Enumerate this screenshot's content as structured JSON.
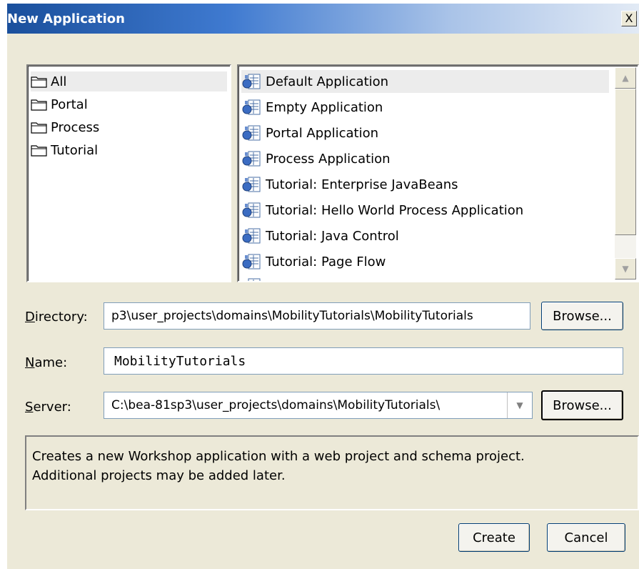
{
  "window": {
    "title": "New Application",
    "close_glyph": "X"
  },
  "categories": [
    "All",
    "Portal",
    "Process",
    "Tutorial"
  ],
  "templates": [
    "Default Application",
    "Empty Application",
    "Portal Application",
    "Process Application",
    "Tutorial: Enterprise JavaBeans",
    "Tutorial: Hello World Process Application",
    "Tutorial: Java Control",
    "Tutorial: Page Flow"
  ],
  "directory": {
    "label_key": "D",
    "label_rest": "irectory:",
    "value": "p3\\user_projects\\domains\\MobilityTutorials\\MobilityTutorials",
    "browse_label": "Browse..."
  },
  "name": {
    "label_key": "N",
    "label_rest": "ame:",
    "value": "MobilityTutorials"
  },
  "server": {
    "label_key": "S",
    "label_rest": "erver:",
    "value": "C:\\bea-81sp3\\user_projects\\domains\\MobilityTutorials\\",
    "browse_label": "Browse..."
  },
  "description": {
    "line1": "Creates a new Workshop application with a web project and schema project.",
    "line2": "Additional projects may be added later."
  },
  "buttons": {
    "create": "Create",
    "cancel": "Cancel"
  },
  "icons": {
    "folder": "folder-icon",
    "template": "application-template-icon"
  }
}
